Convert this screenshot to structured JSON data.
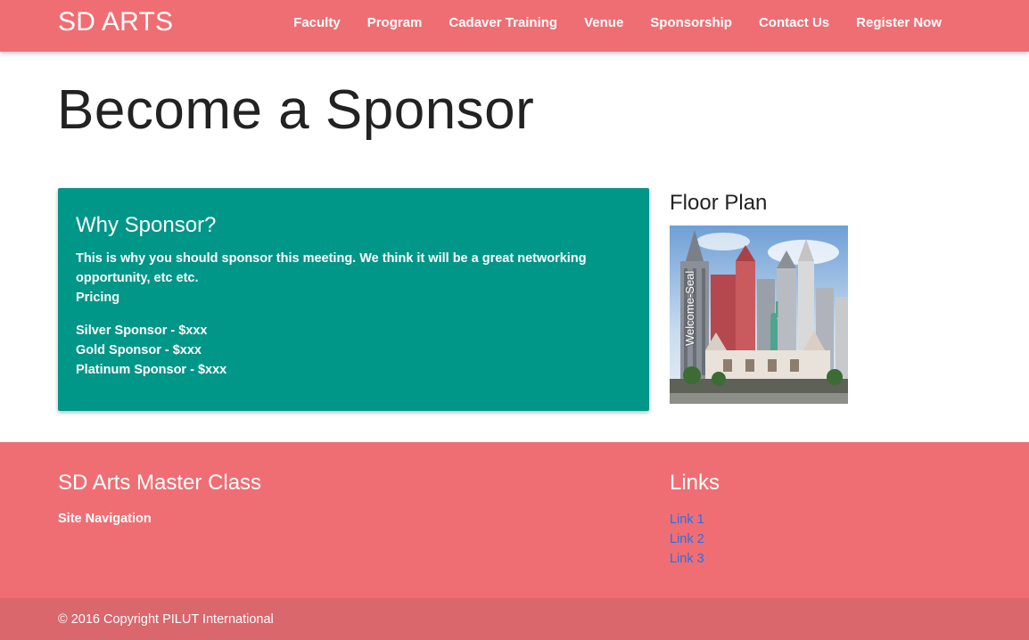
{
  "navbar": {
    "brand": "SD ARTS",
    "items": [
      {
        "label": "Faculty"
      },
      {
        "label": "Program"
      },
      {
        "label": "Cadaver Training"
      },
      {
        "label": "Venue"
      },
      {
        "label": "Sponsorship"
      },
      {
        "label": "Contact Us"
      },
      {
        "label": "Register Now"
      }
    ]
  },
  "main": {
    "title": "Become a Sponsor",
    "card": {
      "heading": "Why Sponsor?",
      "body": "This is why you should sponsor this meeting. We think it will be a great networking opportunity, etc etc.",
      "pricing_label": "Pricing",
      "tiers": [
        {
          "label": "Silver Sponsor - $xxx"
        },
        {
          "label": "Gold Sponsor - $xxx"
        },
        {
          "label": "Platinum Sponsor - $xxx"
        }
      ]
    },
    "floor_plan": {
      "heading": "Floor Plan",
      "image_label": "Welcome-Seal"
    }
  },
  "footer": {
    "left_heading": "SD Arts Master Class",
    "left_sub": "Site Navigation",
    "right_heading": "Links",
    "links": [
      {
        "label": "Link 1"
      },
      {
        "label": "Link 2"
      },
      {
        "label": "Link 3"
      }
    ],
    "copyright": "© 2016 Copyright PILUT International"
  },
  "colors": {
    "brand": "#ef6e73",
    "card": "#009688",
    "link": "#2a6fe6",
    "copyright_bar": "#d9676c"
  }
}
